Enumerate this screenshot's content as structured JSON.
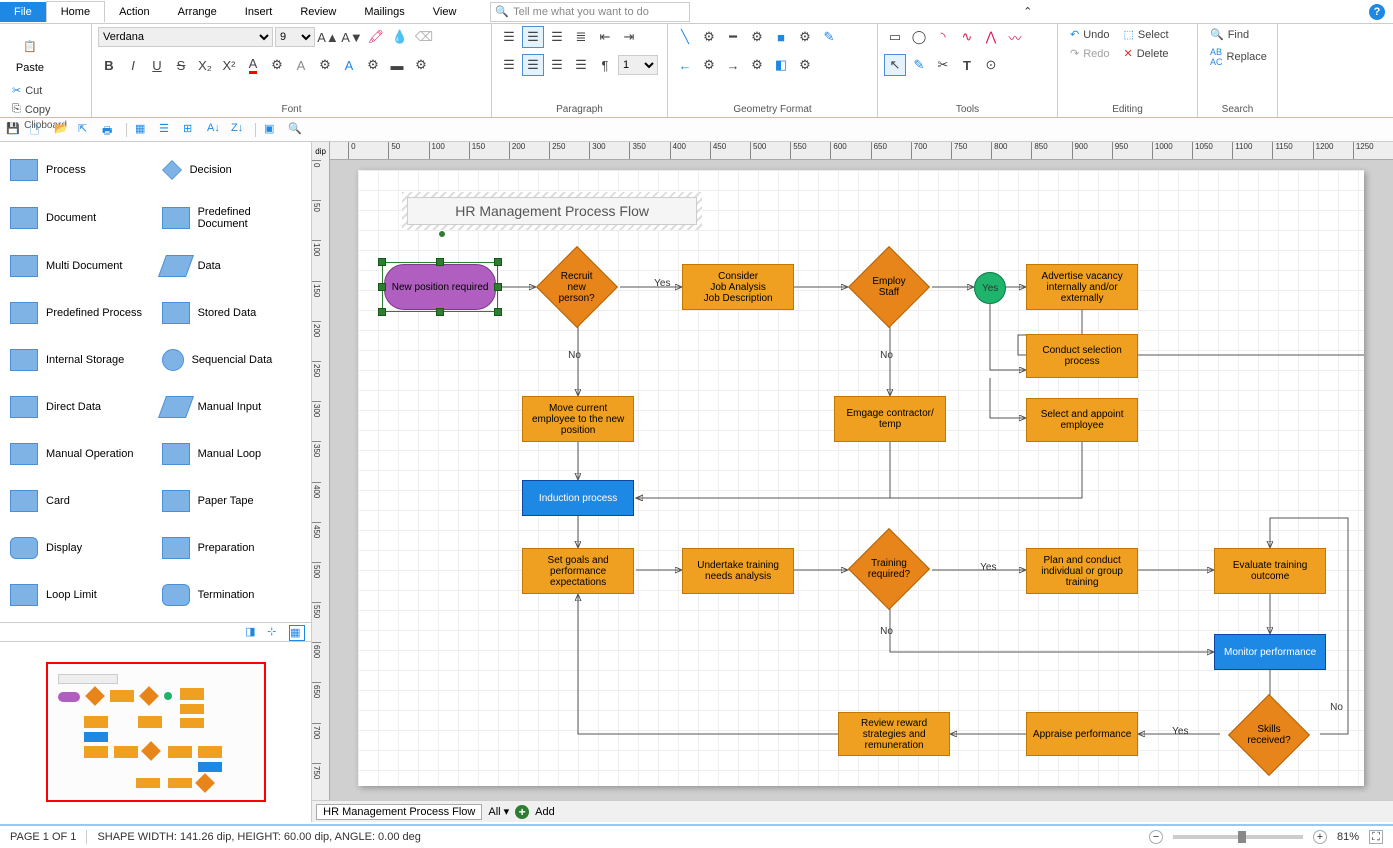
{
  "menu": {
    "file": "File",
    "tabs": [
      "Home",
      "Action",
      "Arrange",
      "Insert",
      "Review",
      "Mailings",
      "View"
    ],
    "active": "Home",
    "search_placeholder": "Tell me what you want to do"
  },
  "ribbon": {
    "clipboard": {
      "label": "Clipboard",
      "paste": "Paste",
      "cut": "Cut",
      "copy": "Copy"
    },
    "font": {
      "label": "Font",
      "name": "Verdana",
      "size": "9"
    },
    "paragraph": {
      "label": "Paragraph",
      "line_spacing": "1"
    },
    "geometry": {
      "label": "Geometry Format"
    },
    "tools": {
      "label": "Tools"
    },
    "editing": {
      "label": "Editing",
      "undo": "Undo",
      "redo": "Redo",
      "select": "Select",
      "delete": "Delete"
    },
    "search": {
      "label": "Search",
      "find": "Find",
      "replace": "Replace"
    }
  },
  "shapes_palette": [
    "Process",
    "Decision",
    "Document",
    "Predefined Document",
    "Multi Document",
    "Data",
    "Predefined Process",
    "Stored Data",
    "Internal Storage",
    "Sequencial Data",
    "Direct Data",
    "Manual Input",
    "Manual Operation",
    "Manual Loop",
    "Card",
    "Paper Tape",
    "Display",
    "Preparation",
    "Loop Limit",
    "Termination"
  ],
  "canvas": {
    "unit_label": "dip",
    "h_ticks": [
      "0",
      "50",
      "100",
      "150",
      "200",
      "250",
      "300",
      "350",
      "400",
      "450",
      "500",
      "550",
      "600",
      "650",
      "700",
      "750",
      "800",
      "850",
      "900",
      "950",
      "1000",
      "1050",
      "1100",
      "1150",
      "1200",
      "1250"
    ],
    "v_ticks": [
      "0",
      "50",
      "100",
      "150",
      "200",
      "250",
      "300",
      "350",
      "400",
      "450",
      "500",
      "550",
      "600",
      "650",
      "700",
      "750"
    ]
  },
  "diagram": {
    "title": "HR Management Process Flow",
    "nodes": {
      "n_start": "New position required",
      "n_recruit_q": "Recruit new person?",
      "n_consider": "Consider\nJob Analysis\nJob Description",
      "n_employ_q": "Employ Staff",
      "n_yes_conn": "Yes",
      "n_advertise": "Advertise vacancy internally and/or externally",
      "n_selection": "Conduct selection process",
      "n_appoint": "Select and appoint employee",
      "n_move": "Move current employee to the new position",
      "n_engage": "Emgage contractor/ temp",
      "n_induction": "Induction process",
      "n_goals": "Set goals and performance expectations",
      "n_needs": "Undertake training needs analysis",
      "n_train_q": "Training required?",
      "n_plan": "Plan and conduct individual or group training",
      "n_eval": "Evaluate training outcome",
      "n_monitor": "Monitor performance",
      "n_appraise": "Appraise performance",
      "n_skills_q": "Skills received?",
      "n_review": "Review reward strategies and remuneration"
    },
    "edge_labels": {
      "yes1": "Yes",
      "no1": "No",
      "no2": "No",
      "yes3": "Yes",
      "no3": "No",
      "yes4": "Yes",
      "no4": "No"
    }
  },
  "tabs": {
    "doc": "HR Management Process Flow",
    "all": "All",
    "add": "Add"
  },
  "status": {
    "page": "PAGE 1 OF 1",
    "shape_info": "SHAPE WIDTH: 141.26 dip, HEIGHT: 60.00 dip, ANGLE: 0.00 deg",
    "zoom": "81%"
  }
}
